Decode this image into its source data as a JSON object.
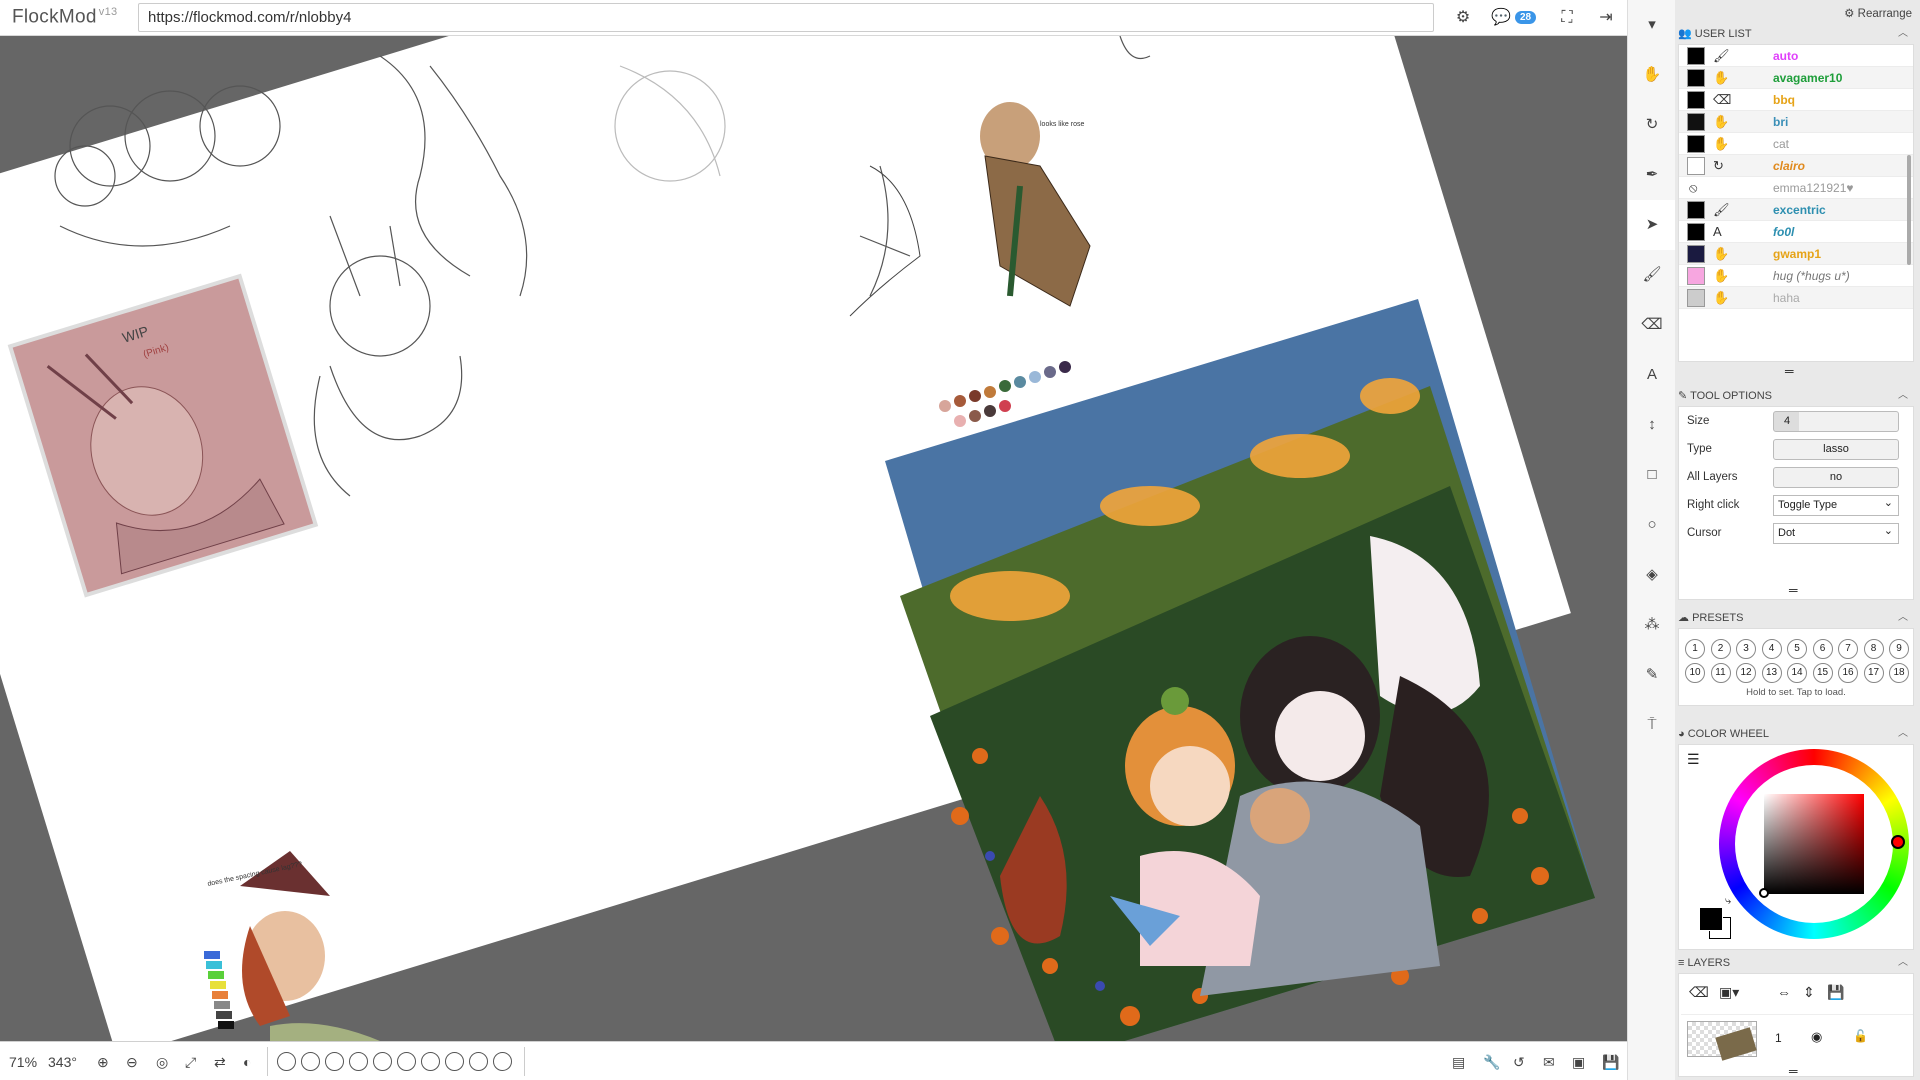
{
  "app": {
    "name": "FlockMod",
    "version": "v13"
  },
  "address": {
    "url": "https://flockmod.com/r/nlobby4"
  },
  "topbar": {
    "chat_count": "28",
    "rearrange_label": "Rearrange"
  },
  "bottombar": {
    "zoom": "71%",
    "rotation": "343°"
  },
  "user_list": {
    "title": "USER LIST",
    "users": [
      {
        "name": "auto",
        "color": "#e040fb",
        "tool": "brush"
      },
      {
        "name": "avagamer10",
        "color": "#1e9e3a",
        "tool": "hand"
      },
      {
        "name": "bbq",
        "color": "#e6a317",
        "tool": "eraser"
      },
      {
        "name": "bri",
        "color": "#3a8fb7",
        "tool": "hand"
      },
      {
        "name": "cat",
        "color": "#999999",
        "tool": "hand"
      },
      {
        "name": "clairo",
        "color": "#e08a1e",
        "tool": "rotate"
      },
      {
        "name": "emma121921♥",
        "color": "#9a9a9a",
        "tool": "blocked"
      },
      {
        "name": "excentric",
        "color": "#2d8fb0",
        "tool": "brush"
      },
      {
        "name": "fo0l",
        "color": "#2d8fb0",
        "tool": "text"
      },
      {
        "name": "gwamp1",
        "color": "#e6a317",
        "tool": "hand"
      },
      {
        "name": "hug (*hugs u*)",
        "color": "#777777",
        "tool": "hand"
      },
      {
        "name": "haha",
        "color": "#aaaaaa",
        "tool": "hand"
      }
    ]
  },
  "tool_options": {
    "title": "TOOL OPTIONS",
    "size_label": "Size",
    "size_value": "4",
    "type_label": "Type",
    "type_value": "lasso",
    "all_layers_label": "All Layers",
    "all_layers_value": "no",
    "right_click_label": "Right click",
    "right_click_value": "Toggle Type",
    "cursor_label": "Cursor",
    "cursor_value": "Dot"
  },
  "presets": {
    "title": "PRESETS",
    "row1": [
      "1",
      "2",
      "3",
      "4",
      "5",
      "6",
      "7",
      "8",
      "9"
    ],
    "row2": [
      "10",
      "11",
      "12",
      "13",
      "14",
      "15",
      "16",
      "17",
      "18"
    ],
    "hint": "Hold to set. Tap to load."
  },
  "color_wheel": {
    "title": "COLOR WHEEL",
    "primary": "#000000",
    "secondary": "#ffffff",
    "hue": "#ff0000"
  },
  "layers": {
    "title": "LAYERS",
    "layer_number": "1"
  },
  "canvas": {
    "note_wip": "WIP",
    "note_pink": "(Pink)",
    "note_looks": "looks like rose",
    "note_spacing": "does the spacing cause lag???"
  }
}
